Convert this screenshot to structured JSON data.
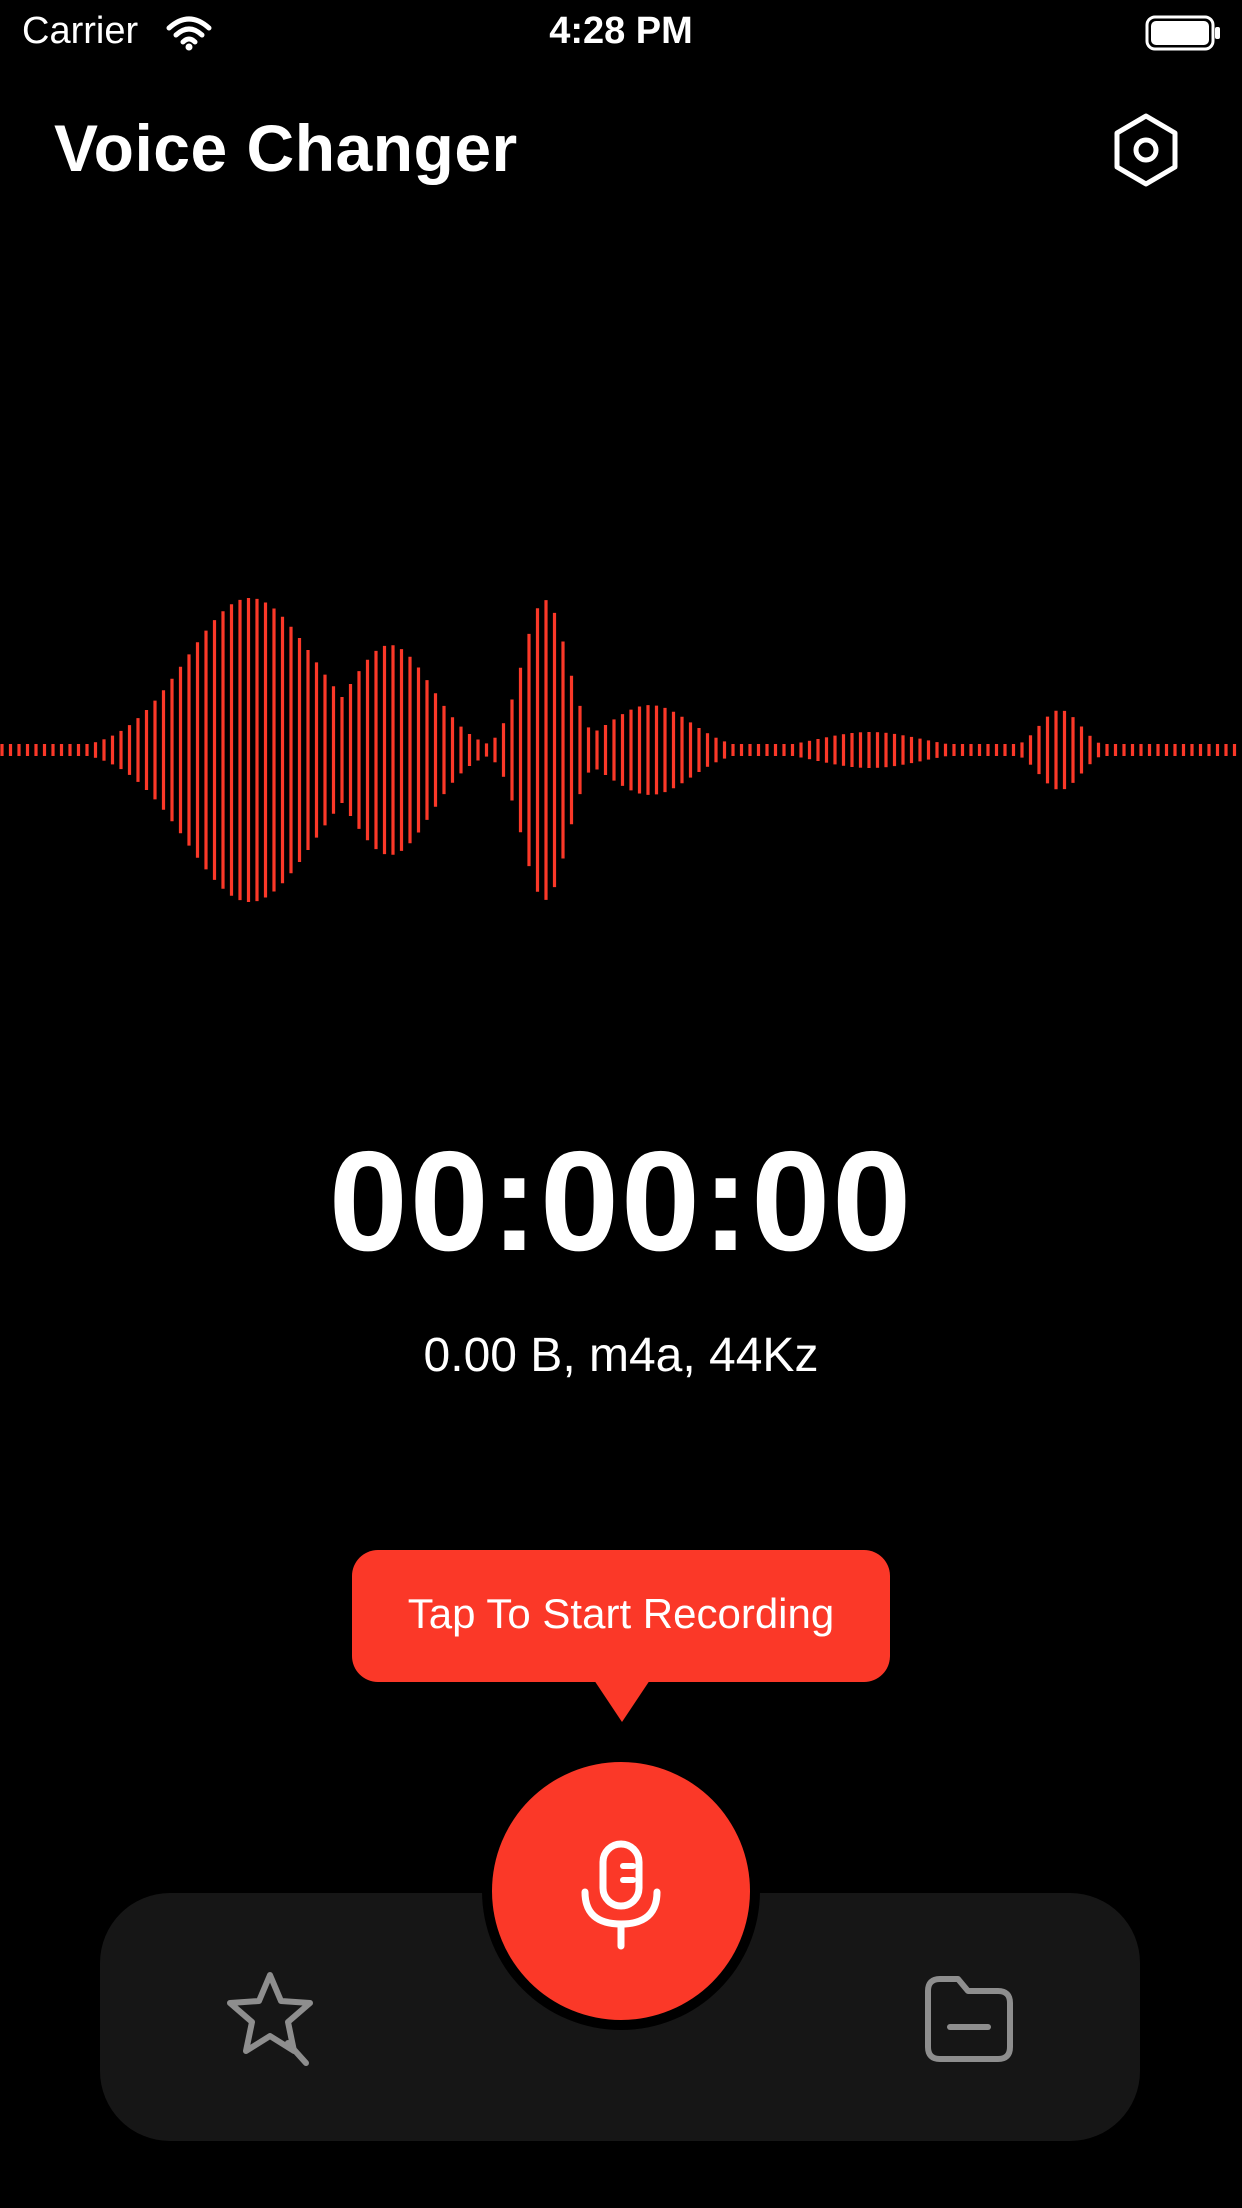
{
  "status_bar": {
    "carrier": "Carrier",
    "time": "4:28 PM"
  },
  "header": {
    "title": "Voice Changer",
    "settings_icon": "gear-icon"
  },
  "recorder": {
    "timer": "00:00:00",
    "file_info": "0.00 B, m4a, 44Kz",
    "tooltip": "Tap To Start Recording",
    "record_icon": "microphone-icon"
  },
  "tab_bar": {
    "left_icon": "star-effects-icon",
    "right_icon": "folder-icon"
  },
  "colors": {
    "accent": "#fb3828",
    "background": "#000000",
    "tab_bar": "#161616",
    "icon_gray": "#8e8e8e"
  }
}
